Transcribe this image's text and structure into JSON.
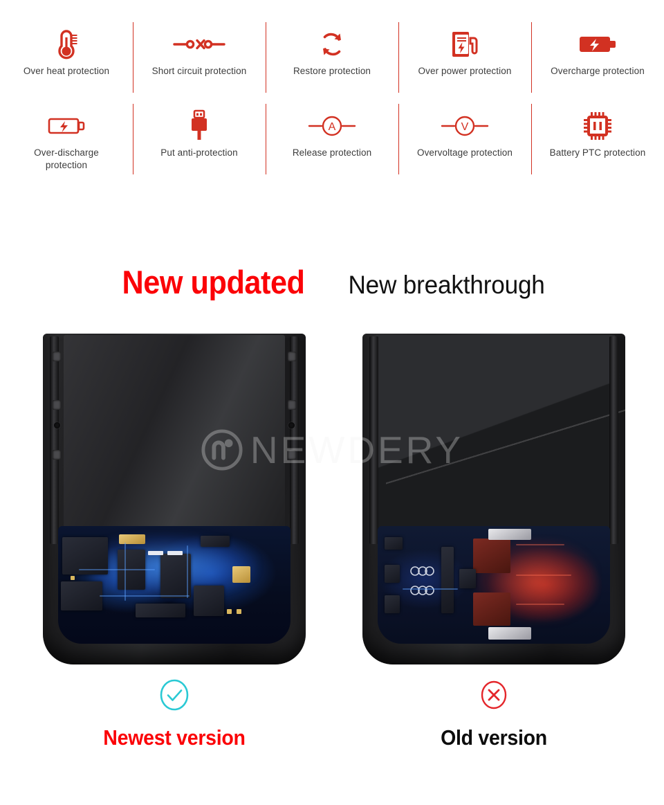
{
  "features": {
    "row1": [
      {
        "label": "Over heat protection",
        "icon": "thermometer-icon"
      },
      {
        "label": "Short circuit protection",
        "icon": "open-circuit-icon"
      },
      {
        "label": "Restore protection",
        "icon": "refresh-cycle-icon"
      },
      {
        "label": "Over power protection",
        "icon": "power-station-icon"
      },
      {
        "label": "Overcharge protection",
        "icon": "battery-filled-bolt-icon"
      }
    ],
    "row2": [
      {
        "label": "Over-discharge\nprotection",
        "icon": "battery-outline-bolt-icon"
      },
      {
        "label": "Put anti-protection",
        "icon": "usb-plug-icon"
      },
      {
        "label": "Release protection",
        "icon": "ammeter-icon"
      },
      {
        "label": "Overvoltage protection",
        "icon": "voltmeter-icon"
      },
      {
        "label": "Battery PTC protection",
        "icon": "ic-chip-icon"
      }
    ]
  },
  "headline": {
    "red": "New updated",
    "black": "New breakthrough"
  },
  "watermark": {
    "text": "NEWDERY",
    "mark": "newdery-logo-mark"
  },
  "comparison": {
    "left": {
      "label": "Newest version",
      "status_icon": "check-circle-icon"
    },
    "right": {
      "label": "Old version",
      "status_icon": "cross-circle-icon"
    }
  },
  "colors": {
    "icon_red": "#d23122",
    "headline_red": "#fb0207",
    "label_gray": "#3c3c3c",
    "divider_red": "#d23122",
    "check_cyan": "#2ac9d4",
    "cross_red": "#e4262b",
    "background": "#ffffff"
  }
}
